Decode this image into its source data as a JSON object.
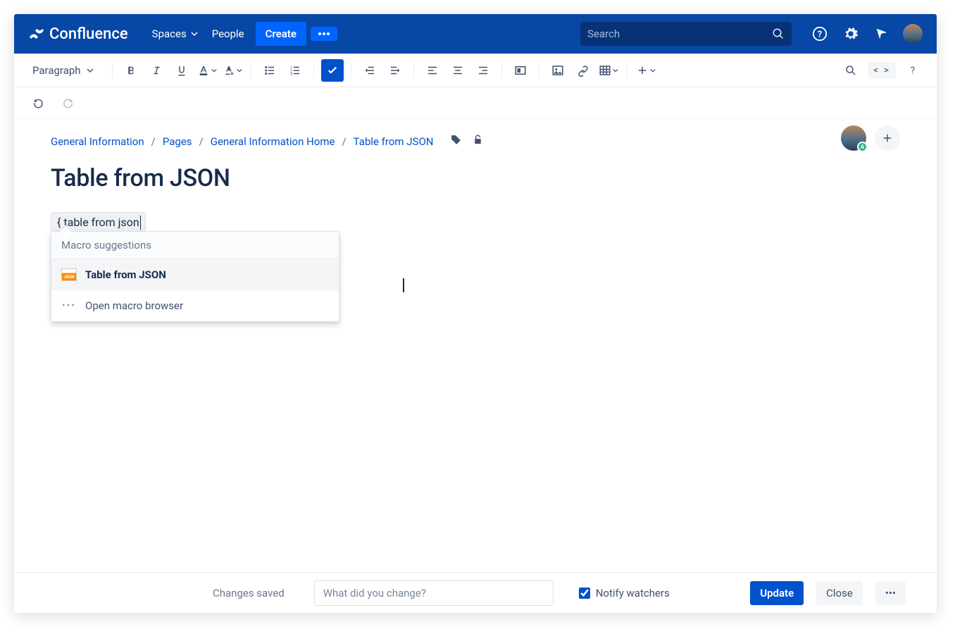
{
  "header": {
    "product": "Confluence",
    "nav": {
      "spaces": "Spaces",
      "people": "People",
      "create": "Create"
    },
    "search_placeholder": "Search"
  },
  "toolbar": {
    "style_dd": "Paragraph",
    "code_toggle": "< >"
  },
  "breadcrumbs": [
    "General Information",
    "Pages",
    "General Information Home",
    "Table from JSON"
  ],
  "page": {
    "title": "Table from JSON",
    "macro_input": "{ table from json",
    "avatar_badge": "A"
  },
  "dropdown": {
    "heading": "Macro suggestions",
    "item1": "Table from JSON",
    "item2": "Open macro browser"
  },
  "footer": {
    "status": "Changes saved",
    "comment_placeholder": "What did you change?",
    "notify": "Notify watchers",
    "update": "Update",
    "close": "Close"
  }
}
